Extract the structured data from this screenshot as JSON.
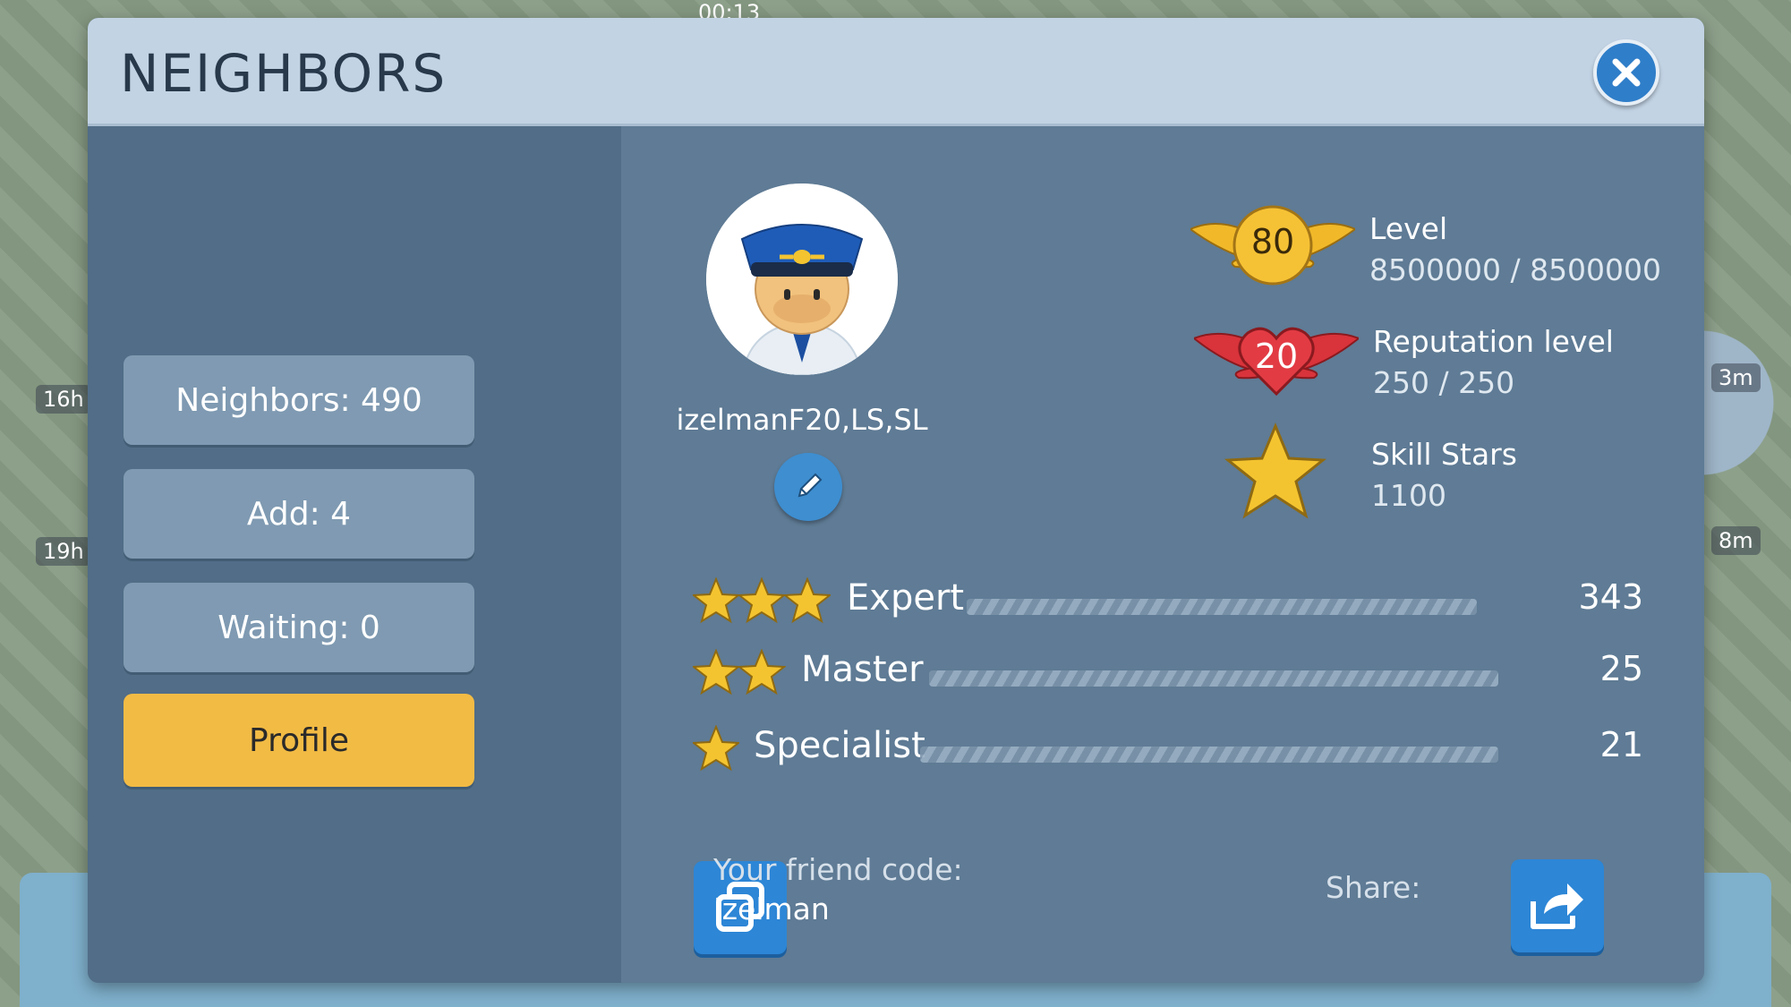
{
  "hud": {
    "clock": "00:13",
    "timers": [
      "16h",
      "19h",
      "3m",
      "8m"
    ]
  },
  "dialog": {
    "title": "NEIGHBORS",
    "close_icon": "close-icon",
    "sidebar": {
      "items": [
        {
          "label": "Neighbors: 490",
          "active": false
        },
        {
          "label": "Add: 4",
          "active": false
        },
        {
          "label": "Waiting: 0",
          "active": false
        },
        {
          "label": "Profile",
          "active": true
        }
      ]
    },
    "profile": {
      "username": "izelmanF20,LS,SL",
      "level_badge": "80",
      "level_label": "Level",
      "level_value": "8500000 / 8500000",
      "rep_badge": "20",
      "rep_label": "Reputation level",
      "rep_value": "250 / 250",
      "skill_label": "Skill Stars",
      "skill_value": "1100",
      "skills": [
        {
          "name": "Expert",
          "stars": 3,
          "count": "343"
        },
        {
          "name": "Master",
          "stars": 2,
          "count": "25"
        },
        {
          "name": "Specialist",
          "stars": 1,
          "count": "21"
        }
      ],
      "friend_code_label": "Your friend code:",
      "friend_code": "Izelman",
      "share_label": "Share:"
    }
  },
  "colors": {
    "accent": "#f2bb44",
    "button_blue": "#2d86d6",
    "panel": "#5f7b95"
  }
}
